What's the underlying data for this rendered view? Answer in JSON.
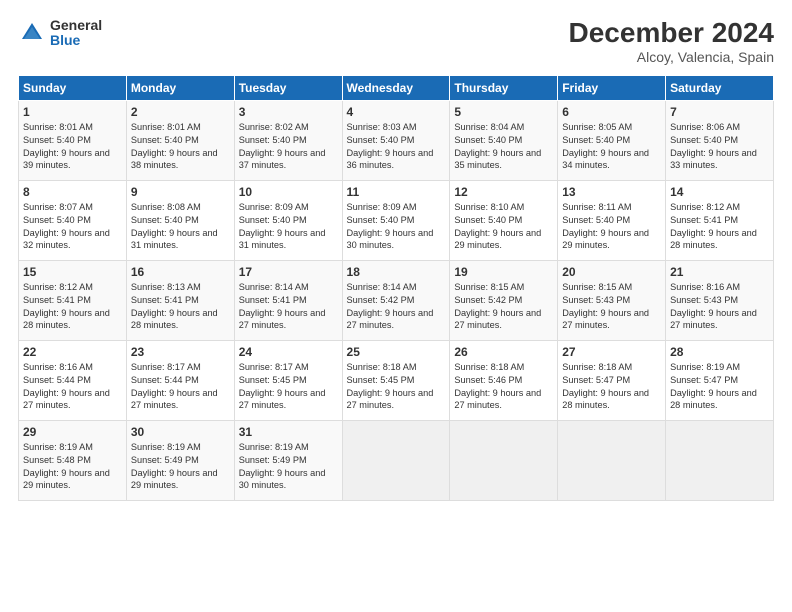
{
  "header": {
    "logo_general": "General",
    "logo_blue": "Blue",
    "month_title": "December 2024",
    "location": "Alcoy, Valencia, Spain"
  },
  "calendar": {
    "headers": [
      "Sunday",
      "Monday",
      "Tuesday",
      "Wednesday",
      "Thursday",
      "Friday",
      "Saturday"
    ],
    "weeks": [
      [
        {
          "day": "",
          "detail": ""
        },
        {
          "day": "2",
          "detail": "Sunrise: 8:01 AM\nSunset: 5:40 PM\nDaylight: 9 hours\nand 38 minutes."
        },
        {
          "day": "3",
          "detail": "Sunrise: 8:02 AM\nSunset: 5:40 PM\nDaylight: 9 hours\nand 37 minutes."
        },
        {
          "day": "4",
          "detail": "Sunrise: 8:03 AM\nSunset: 5:40 PM\nDaylight: 9 hours\nand 36 minutes."
        },
        {
          "day": "5",
          "detail": "Sunrise: 8:04 AM\nSunset: 5:40 PM\nDaylight: 9 hours\nand 35 minutes."
        },
        {
          "day": "6",
          "detail": "Sunrise: 8:05 AM\nSunset: 5:40 PM\nDaylight: 9 hours\nand 34 minutes."
        },
        {
          "day": "7",
          "detail": "Sunrise: 8:06 AM\nSunset: 5:40 PM\nDaylight: 9 hours\nand 33 minutes."
        }
      ],
      [
        {
          "day": "8",
          "detail": "Sunrise: 8:07 AM\nSunset: 5:40 PM\nDaylight: 9 hours\nand 32 minutes."
        },
        {
          "day": "9",
          "detail": "Sunrise: 8:08 AM\nSunset: 5:40 PM\nDaylight: 9 hours\nand 31 minutes."
        },
        {
          "day": "10",
          "detail": "Sunrise: 8:09 AM\nSunset: 5:40 PM\nDaylight: 9 hours\nand 31 minutes."
        },
        {
          "day": "11",
          "detail": "Sunrise: 8:09 AM\nSunset: 5:40 PM\nDaylight: 9 hours\nand 30 minutes."
        },
        {
          "day": "12",
          "detail": "Sunrise: 8:10 AM\nSunset: 5:40 PM\nDaylight: 9 hours\nand 29 minutes."
        },
        {
          "day": "13",
          "detail": "Sunrise: 8:11 AM\nSunset: 5:40 PM\nDaylight: 9 hours\nand 29 minutes."
        },
        {
          "day": "14",
          "detail": "Sunrise: 8:12 AM\nSunset: 5:41 PM\nDaylight: 9 hours\nand 28 minutes."
        }
      ],
      [
        {
          "day": "15",
          "detail": "Sunrise: 8:12 AM\nSunset: 5:41 PM\nDaylight: 9 hours\nand 28 minutes."
        },
        {
          "day": "16",
          "detail": "Sunrise: 8:13 AM\nSunset: 5:41 PM\nDaylight: 9 hours\nand 28 minutes."
        },
        {
          "day": "17",
          "detail": "Sunrise: 8:14 AM\nSunset: 5:41 PM\nDaylight: 9 hours\nand 27 minutes."
        },
        {
          "day": "18",
          "detail": "Sunrise: 8:14 AM\nSunset: 5:42 PM\nDaylight: 9 hours\nand 27 minutes."
        },
        {
          "day": "19",
          "detail": "Sunrise: 8:15 AM\nSunset: 5:42 PM\nDaylight: 9 hours\nand 27 minutes."
        },
        {
          "day": "20",
          "detail": "Sunrise: 8:15 AM\nSunset: 5:43 PM\nDaylight: 9 hours\nand 27 minutes."
        },
        {
          "day": "21",
          "detail": "Sunrise: 8:16 AM\nSunset: 5:43 PM\nDaylight: 9 hours\nand 27 minutes."
        }
      ],
      [
        {
          "day": "22",
          "detail": "Sunrise: 8:16 AM\nSunset: 5:44 PM\nDaylight: 9 hours\nand 27 minutes."
        },
        {
          "day": "23",
          "detail": "Sunrise: 8:17 AM\nSunset: 5:44 PM\nDaylight: 9 hours\nand 27 minutes."
        },
        {
          "day": "24",
          "detail": "Sunrise: 8:17 AM\nSunset: 5:45 PM\nDaylight: 9 hours\nand 27 minutes."
        },
        {
          "day": "25",
          "detail": "Sunrise: 8:18 AM\nSunset: 5:45 PM\nDaylight: 9 hours\nand 27 minutes."
        },
        {
          "day": "26",
          "detail": "Sunrise: 8:18 AM\nSunset: 5:46 PM\nDaylight: 9 hours\nand 27 minutes."
        },
        {
          "day": "27",
          "detail": "Sunrise: 8:18 AM\nSunset: 5:47 PM\nDaylight: 9 hours\nand 28 minutes."
        },
        {
          "day": "28",
          "detail": "Sunrise: 8:19 AM\nSunset: 5:47 PM\nDaylight: 9 hours\nand 28 minutes."
        }
      ],
      [
        {
          "day": "29",
          "detail": "Sunrise: 8:19 AM\nSunset: 5:48 PM\nDaylight: 9 hours\nand 29 minutes."
        },
        {
          "day": "30",
          "detail": "Sunrise: 8:19 AM\nSunset: 5:49 PM\nDaylight: 9 hours\nand 29 minutes."
        },
        {
          "day": "31",
          "detail": "Sunrise: 8:19 AM\nSunset: 5:49 PM\nDaylight: 9 hours\nand 30 minutes."
        },
        {
          "day": "",
          "detail": ""
        },
        {
          "day": "",
          "detail": ""
        },
        {
          "day": "",
          "detail": ""
        },
        {
          "day": "",
          "detail": ""
        }
      ]
    ],
    "week0_day1": "1",
    "week0_day1_detail": "Sunrise: 8:01 AM\nSunset: 5:40 PM\nDaylight: 9 hours\nand 39 minutes."
  }
}
